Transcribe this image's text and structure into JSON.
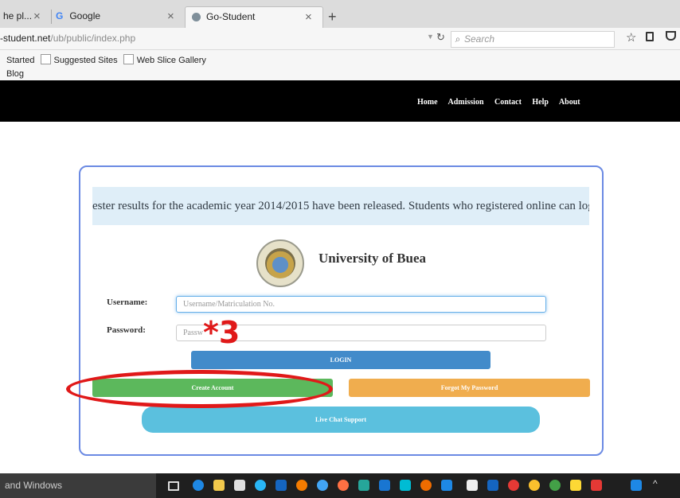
{
  "browser": {
    "tabs": [
      {
        "label": "he pl...",
        "close": "×"
      },
      {
        "label": "Google",
        "close": "×"
      },
      {
        "label": "Go-Student",
        "close": "×"
      }
    ],
    "new_tab": "+",
    "url_host": "-student.net",
    "url_path": "/ub/public/index.php",
    "search_placeholder": "Search",
    "bookmarks": [
      "Started",
      "Suggested Sites",
      "Web Slice Gallery",
      "Blog"
    ]
  },
  "site": {
    "nav": [
      "Home",
      "Admission",
      "Contact",
      "Help",
      "About"
    ],
    "announcement": "ester results for the academic year 2014/2015 have been released. Students who registered online can login",
    "university_name": "University of Buea",
    "username_label": "Username:",
    "username_placeholder": "Username/Matriculation No.",
    "password_label": "Password:",
    "password_placeholder": "Passw",
    "login_label": "LOGIN",
    "create_account_label": "Create Account",
    "forgot_password_label": "Forgot My Password",
    "live_chat_label": "Live Chat Support"
  },
  "annotation": {
    "text": "*3",
    "color": "#e01919"
  },
  "taskbar": {
    "search_text": "and Windows"
  },
  "colors": {
    "header_bg": "#000000",
    "login": "#428bca",
    "create": "#5cb85c",
    "forgot": "#f0ad4e",
    "chat": "#5bc0de",
    "card_border": "#6b8ae3",
    "banner_bg": "#dfeef8"
  }
}
